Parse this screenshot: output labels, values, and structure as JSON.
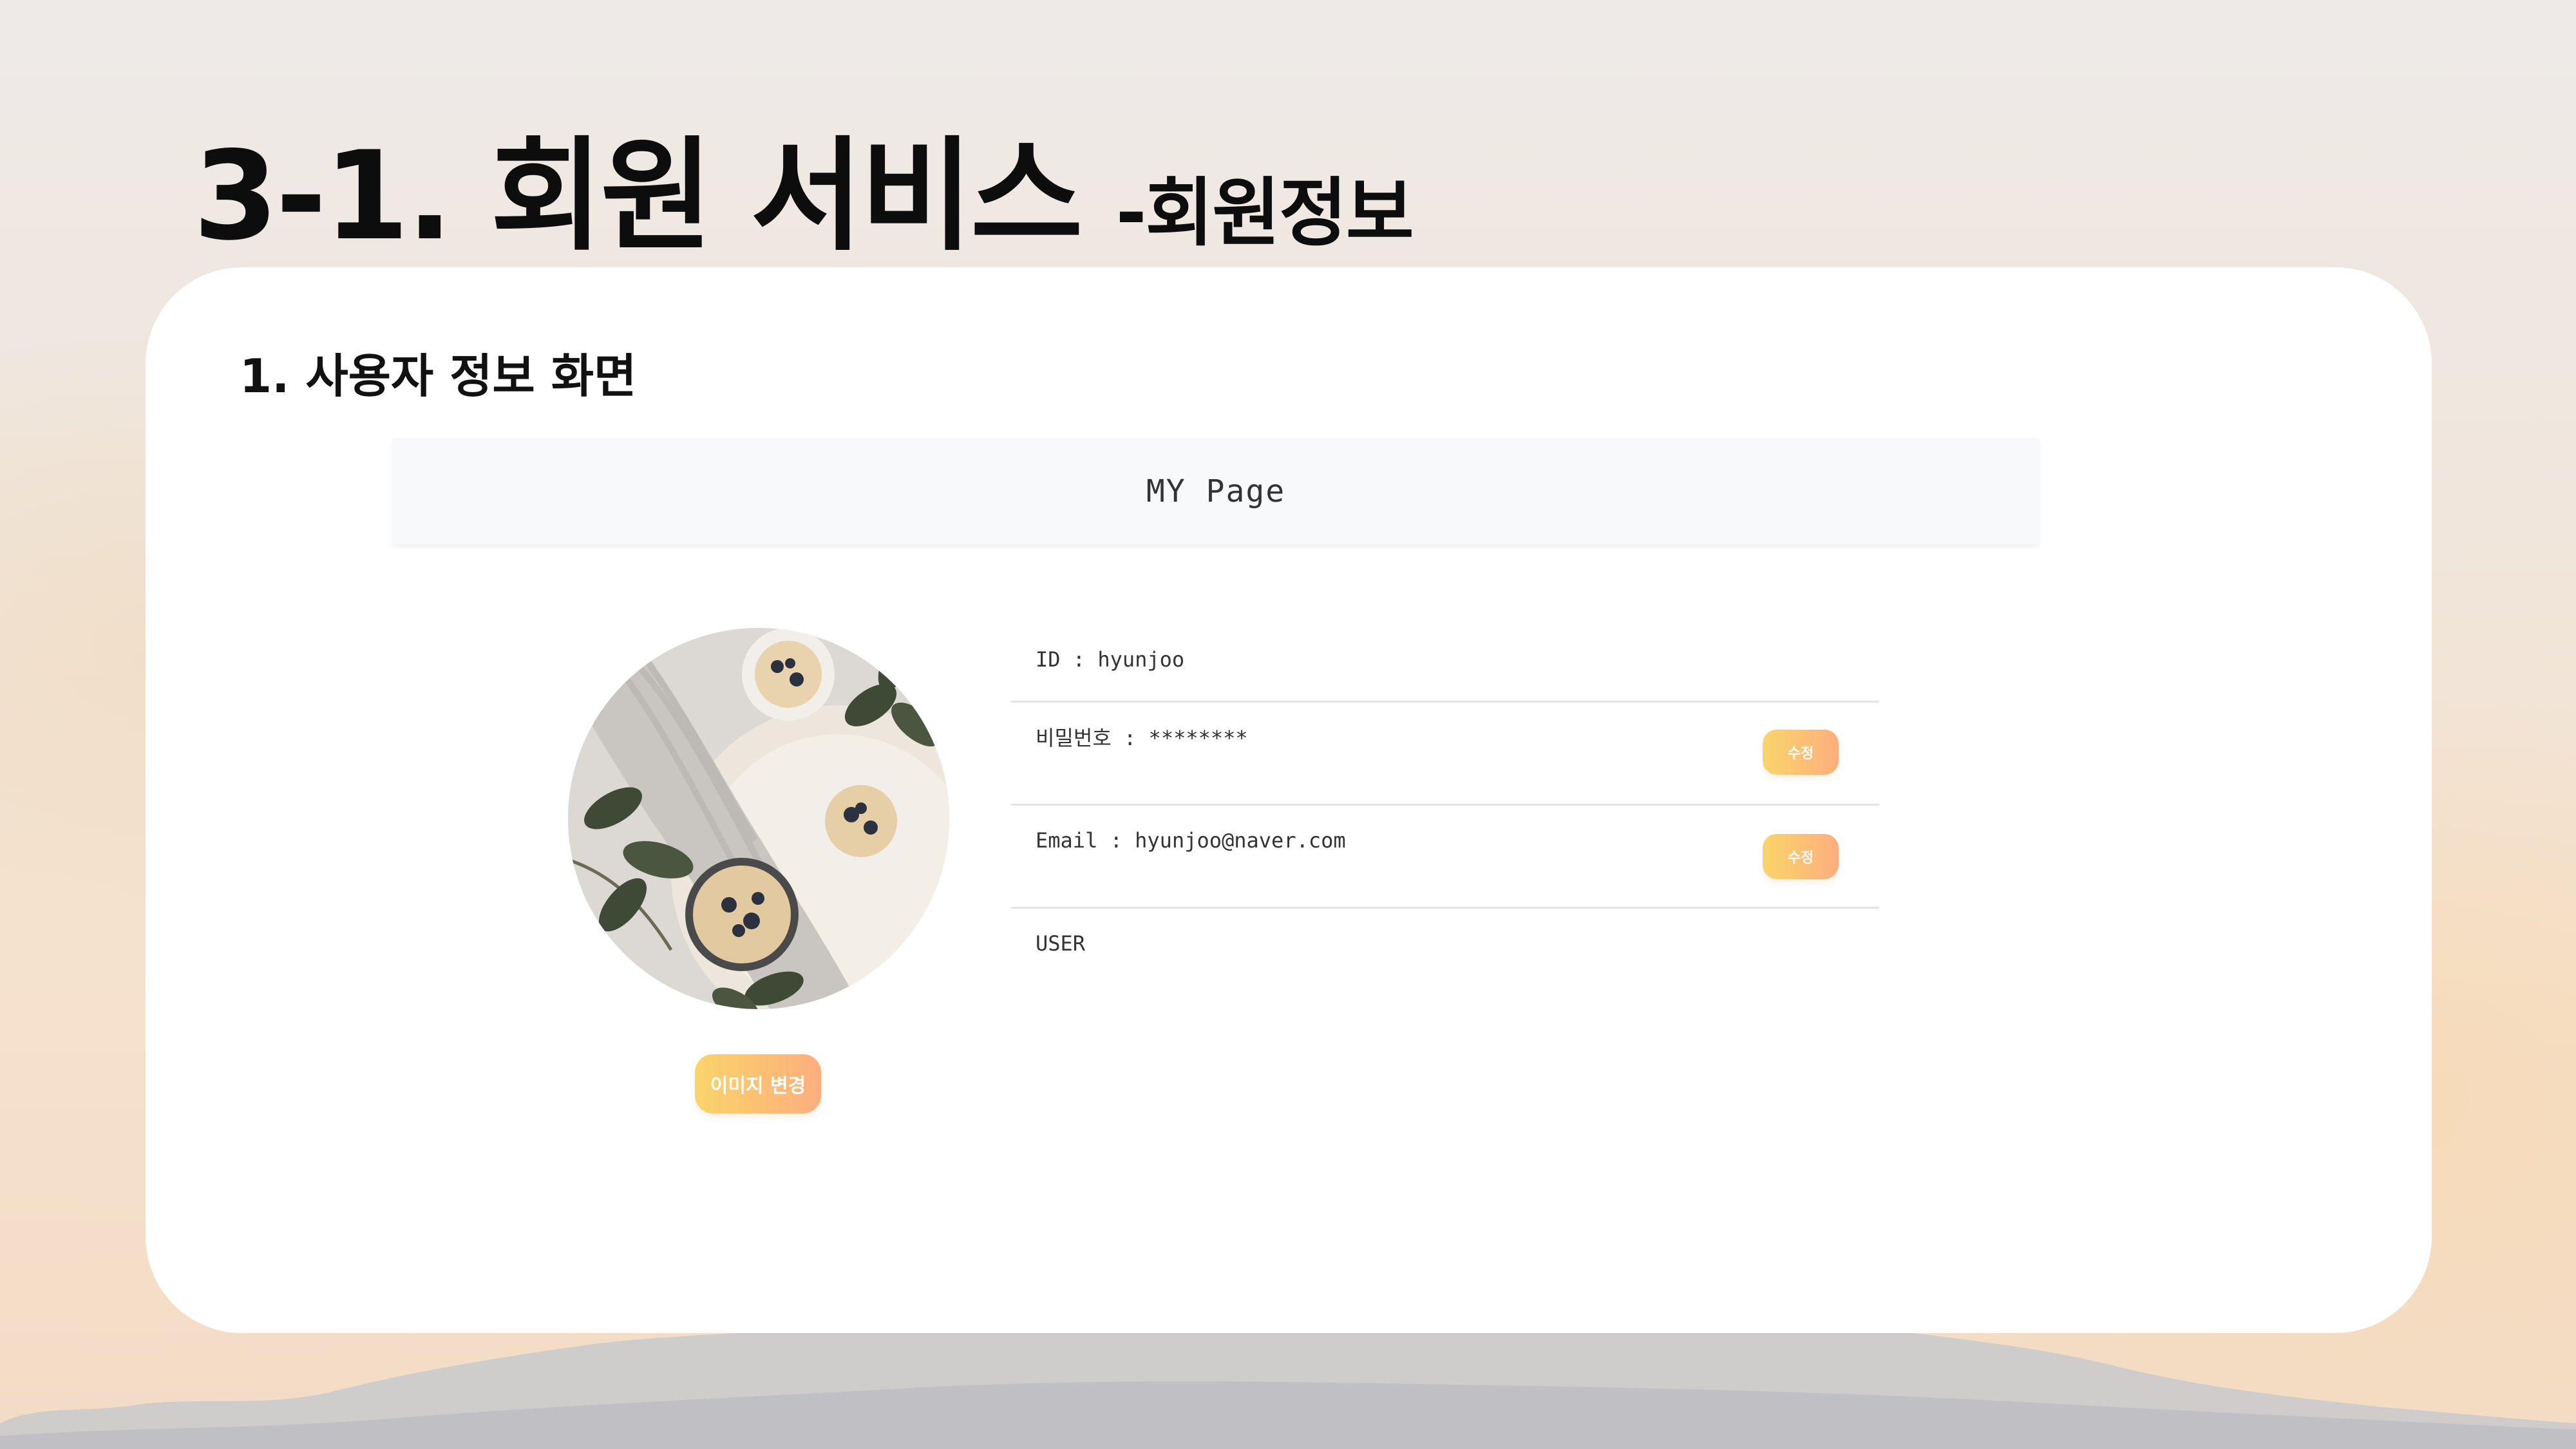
{
  "slide": {
    "title": "3-1. 회원 서비스",
    "subtitle": "-회원정보"
  },
  "section": {
    "heading": "1. 사용자 정보 화면"
  },
  "mypage": {
    "header": "MY Page",
    "profile_image": {
      "description_icon": "food-photo",
      "change_button": "이미지 변경"
    },
    "rows": [
      {
        "text": "ID : hyunjoo"
      },
      {
        "text": "비밀번호 : ********",
        "button": "수정"
      },
      {
        "text": "Email : hyunjoo@naver.com",
        "button": "수정"
      },
      {
        "text": "USER"
      }
    ]
  },
  "colors": {
    "button_gradient_start": "#fbd46a",
    "button_gradient_end": "#fcae7e",
    "card_background": "#ffffff",
    "header_background": "#f8f9fa"
  }
}
